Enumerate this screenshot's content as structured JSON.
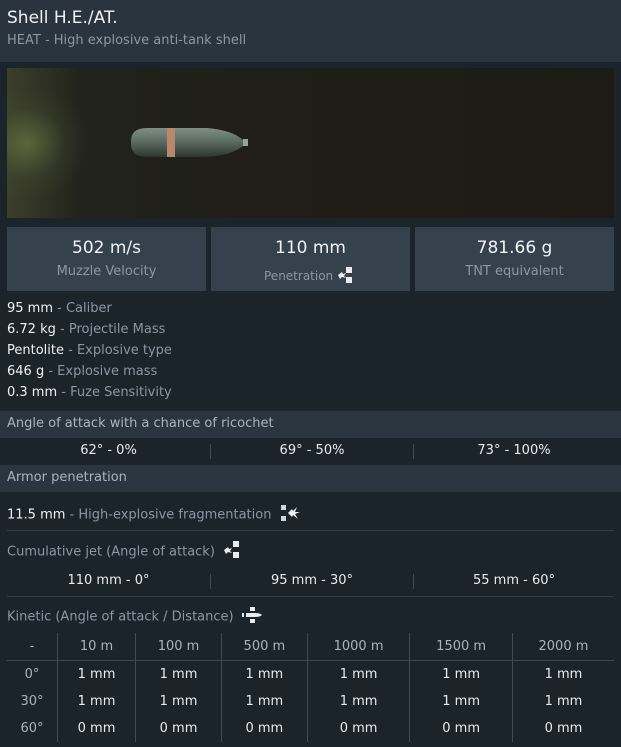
{
  "header": {
    "title": "Shell H.E./AT.",
    "subtitle": "HEAT - High explosive anti-tank shell"
  },
  "stats": [
    {
      "value": "502 m/s",
      "label": "Muzzle Velocity"
    },
    {
      "value": "110 mm",
      "label": "Penetration"
    },
    {
      "value": "781.66 g",
      "label": "TNT equivalent"
    }
  ],
  "properties": [
    {
      "value": "95 mm",
      "label": "Caliber"
    },
    {
      "value": "6.72 kg",
      "label": "Projectile Mass"
    },
    {
      "value": "Pentolite",
      "label": "Explosive type"
    },
    {
      "value": "646 g",
      "label": "Explosive mass"
    },
    {
      "value": "0.3 mm",
      "label": "Fuze Sensitivity"
    }
  ],
  "ricochet": {
    "title": "Angle of attack with a chance of ricochet",
    "cells": [
      "62° - 0%",
      "69° - 50%",
      "73° - 100%"
    ]
  },
  "armor": {
    "title": "Armor penetration",
    "fragmentation": {
      "value": "11.5 mm",
      "label": "High-explosive fragmentation"
    },
    "jet_title": "Cumulative jet (Angle of attack)",
    "jet": [
      {
        "value": "110 mm",
        "angle": "0°"
      },
      {
        "value": "95 mm",
        "angle": "30°"
      },
      {
        "value": "55 mm",
        "angle": "60°"
      }
    ],
    "kinetic_title": "Kinetic (Angle of attack / Distance)",
    "kinetic": {
      "headers": [
        "-",
        "10 m",
        "100 m",
        "500 m",
        "1000 m",
        "1500 m",
        "2000 m"
      ],
      "rows": [
        [
          "0°",
          "1 mm",
          "1 mm",
          "1 mm",
          "1 mm",
          "1 mm",
          "1 mm"
        ],
        [
          "30°",
          "1 mm",
          "1 mm",
          "1 mm",
          "1 mm",
          "1 mm",
          "1 mm"
        ],
        [
          "60°",
          "0 mm",
          "0 mm",
          "0 mm",
          "0 mm",
          "0 mm",
          "0 mm"
        ]
      ]
    }
  },
  "icons": {
    "shell": "shell-projectile-icon",
    "penetration": "penetration-impact-icon",
    "fragmentation": "fragmentation-burst-icon",
    "jet": "cumulative-jet-icon",
    "kinetic": "kinetic-shell-icon"
  },
  "colors": {
    "background": "#1b232b",
    "header": "#2a343e",
    "stat_box": "#35414d",
    "muted_text": "#8b98a4"
  }
}
